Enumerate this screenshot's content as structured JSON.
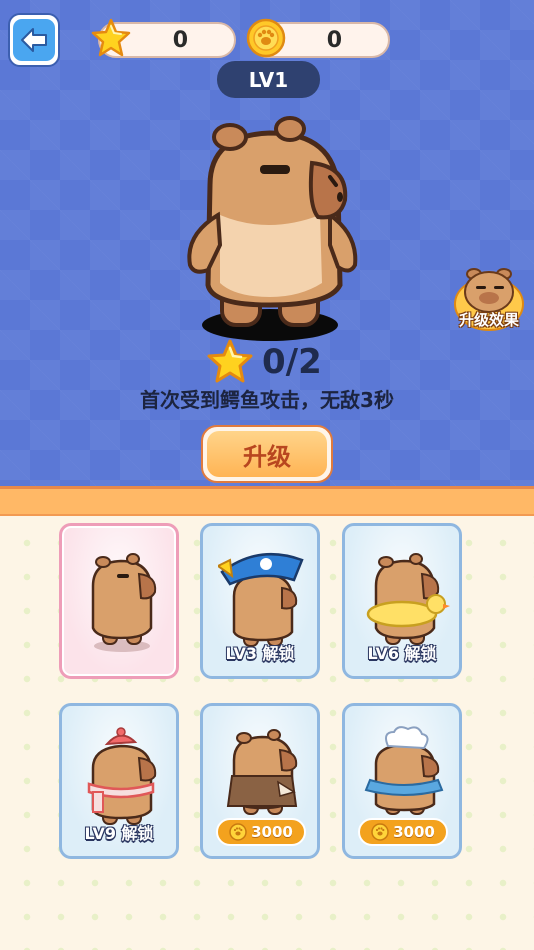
{
  "header": {
    "star_count": "0",
    "coin_count": "0",
    "level": "LV1"
  },
  "hero": {
    "progress": "0/2",
    "description": "首次受到鳄鱼攻击，无敌3秒",
    "upgrade_label": "升级",
    "effect_label": "升级效果"
  },
  "skins": [
    {
      "name": "default",
      "label": "",
      "selected": true
    },
    {
      "name": "pirate-hat",
      "label": "LV3 解锁"
    },
    {
      "name": "duck-float",
      "label": "LV6 解锁"
    },
    {
      "name": "scarf",
      "label": "LV9 解锁"
    },
    {
      "name": "cape",
      "price": "3000"
    },
    {
      "name": "chef-hat",
      "price": "3000"
    }
  ],
  "colors": {
    "background_top": "#5b78d6",
    "accent_orange": "#ffb866",
    "capybara_fur": "#d9a06b"
  }
}
